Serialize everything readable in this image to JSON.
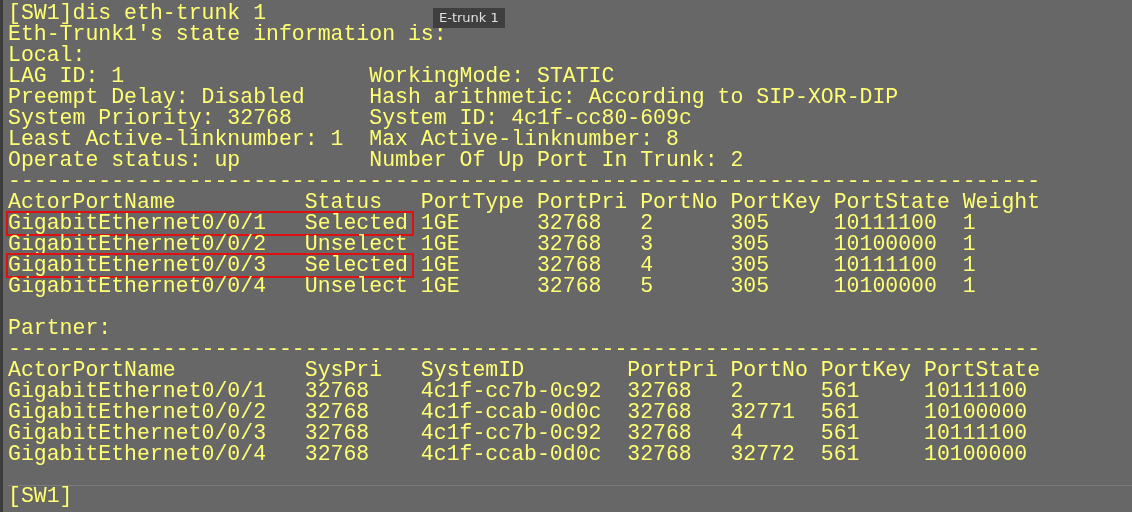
{
  "tooltip": "E-trunk 1",
  "command": "[SW1]dis eth-trunk 1",
  "heading": "Eth-Trunk1's state information is:",
  "local": {
    "label": "Local:",
    "info": [
      [
        "LAG ID: 1",
        "WorkingMode: STATIC"
      ],
      [
        "Preempt Delay: Disabled",
        "Hash arithmetic: According to SIP-XOR-DIP"
      ],
      [
        "System Priority: 32768",
        "System ID: 4c1f-cc80-609c"
      ],
      [
        "Least Active-linknumber: 1",
        "Max Active-linknumber: 8"
      ],
      [
        "Operate status: up",
        "Number Of Up Port In Trunk: 2"
      ]
    ],
    "separator": "--------------------------------------------------------------------------------",
    "columns": [
      "ActorPortName",
      "Status",
      "PortType",
      "PortPri",
      "PortNo",
      "PortKey",
      "PortState",
      "Weight"
    ],
    "rows": [
      {
        "cells": [
          "GigabitEthernet0/0/1",
          "Selected",
          "1GE",
          "32768",
          "2",
          "305",
          "10111100",
          "1"
        ],
        "boxed": true
      },
      {
        "cells": [
          "GigabitEthernet0/0/2",
          "Unselect",
          "1GE",
          "32768",
          "3",
          "305",
          "10100000",
          "1"
        ],
        "boxed": false
      },
      {
        "cells": [
          "GigabitEthernet0/0/3",
          "Selected",
          "1GE",
          "32768",
          "4",
          "305",
          "10111100",
          "1"
        ],
        "boxed": true
      },
      {
        "cells": [
          "GigabitEthernet0/0/4",
          "Unselect",
          "1GE",
          "32768",
          "5",
          "305",
          "10100000",
          "1"
        ],
        "boxed": false
      }
    ]
  },
  "partner": {
    "label": "Partner:",
    "separator": "--------------------------------------------------------------------------------",
    "columns": [
      "ActorPortName",
      "SysPri",
      "SystemID",
      "PortPri",
      "PortNo",
      "PortKey",
      "PortState"
    ],
    "rows": [
      {
        "cells": [
          "GigabitEthernet0/0/1",
          "32768",
          "4c1f-cc7b-0c92",
          "32768",
          "2",
          "561",
          "10111100"
        ]
      },
      {
        "cells": [
          "GigabitEthernet0/0/2",
          "32768",
          "4c1f-ccab-0d0c",
          "32768",
          "32771",
          "561",
          "10100000"
        ]
      },
      {
        "cells": [
          "GigabitEthernet0/0/3",
          "32768",
          "4c1f-cc7b-0c92",
          "32768",
          "4",
          "561",
          "10111100"
        ]
      },
      {
        "cells": [
          "GigabitEthernet0/0/4",
          "32768",
          "4c1f-ccab-0d0c",
          "32768",
          "32772",
          "561",
          "10100000"
        ]
      }
    ]
  },
  "prompt": "[SW1]"
}
